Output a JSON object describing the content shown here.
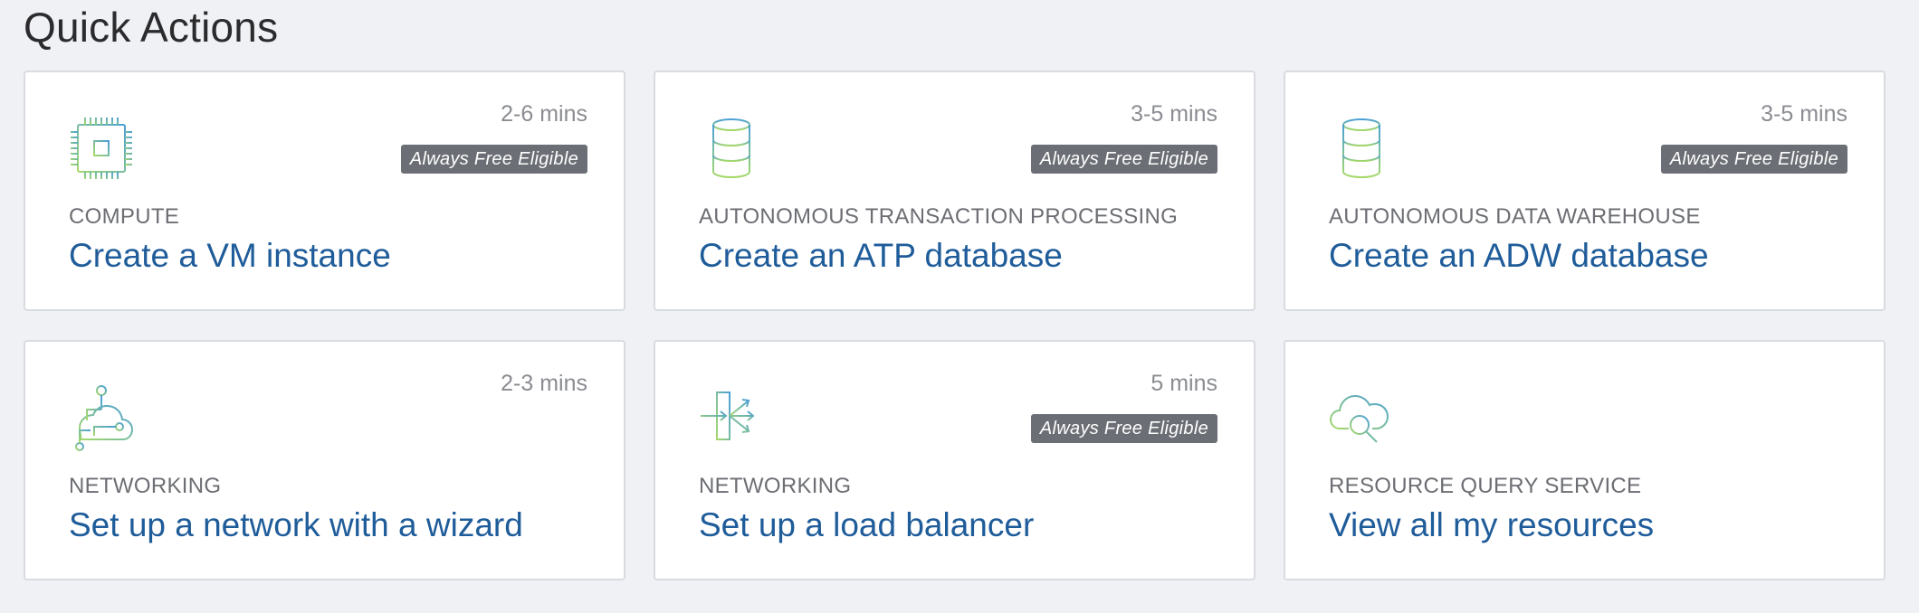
{
  "section": {
    "title": "Quick Actions"
  },
  "cards": [
    {
      "time": "2-6 mins",
      "badge": "Always Free Eligible",
      "category": "COMPUTE",
      "action": "Create a VM instance",
      "icon": "chip-icon"
    },
    {
      "time": "3-5 mins",
      "badge": "Always Free Eligible",
      "category": "AUTONOMOUS TRANSACTION PROCESSING",
      "action": "Create an ATP database",
      "icon": "database-icon"
    },
    {
      "time": "3-5 mins",
      "badge": "Always Free Eligible",
      "category": "AUTONOMOUS DATA WAREHOUSE",
      "action": "Create an ADW database",
      "icon": "database-icon"
    },
    {
      "time": "2-3 mins",
      "category": "NETWORKING",
      "action": "Set up a network with a wizard",
      "icon": "cloud-network-icon"
    },
    {
      "time": "5 mins",
      "badge": "Always Free Eligible",
      "category": "NETWORKING",
      "action": "Set up a load balancer",
      "icon": "load-balancer-icon"
    },
    {
      "category": "RESOURCE QUERY SERVICE",
      "action": "View all my resources",
      "icon": "cloud-search-icon"
    }
  ],
  "colors": {
    "background": "#f0f1f4",
    "card_border": "#d8dbe0",
    "link": "#1f5c9a",
    "badge_bg": "#6b6e74",
    "icon_gradient_start": "#a6d96a",
    "icon_gradient_end": "#4a9fd8"
  }
}
